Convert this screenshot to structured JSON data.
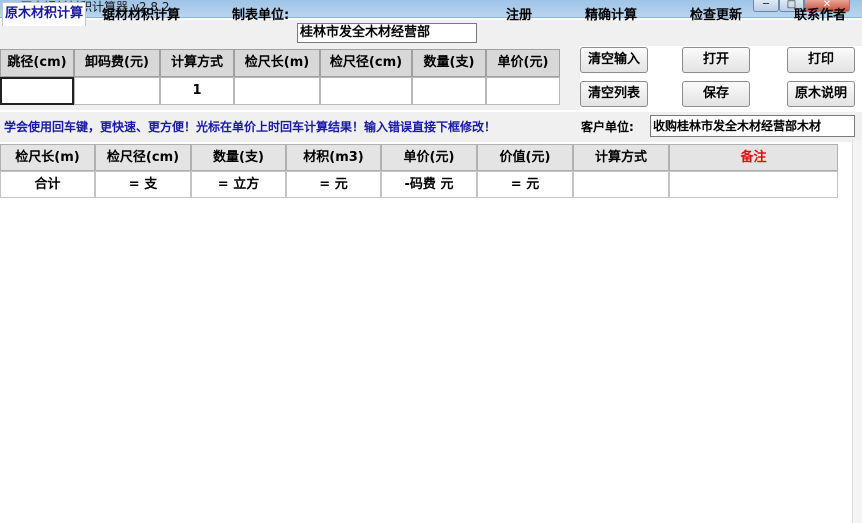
{
  "window": {
    "app_icon": "木",
    "title": "原木锯材材积计算器 v2.8.2",
    "min_glyph": "─",
    "max_glyph": "□",
    "close_glyph": "✕"
  },
  "menu": {
    "tab_log": "原木材积计算",
    "tab_sawn": "锯材材积计算",
    "unit_label": "制表单位:",
    "unit_value": "桂林市发全木材经营部",
    "register": "注册",
    "precise": "精确计算",
    "update": "检查更新",
    "contact": "联系作者"
  },
  "input_grid": {
    "headers": [
      "跳径(cm)",
      "卸码费(元)",
      "计算方式",
      "检尺长(m)",
      "检尺径(cm)",
      "数量(支)",
      "单价(元)"
    ],
    "values": [
      "",
      "",
      "1",
      "",
      "",
      "",
      ""
    ]
  },
  "buttons": {
    "clear_input": "清空输入",
    "open": "打开",
    "print": "打印",
    "clear_list": "清空列表",
    "save": "保存",
    "about": "原木说明"
  },
  "hint": {
    "text": "学会使用回车键，更快速、更方便！光标在单价上时回车计算结果！输入错误直接下框修改！",
    "client_label": "客户单位:",
    "client_value": "收购桂林市发全木材经营部木材"
  },
  "results": {
    "headers": [
      "检尺长(m)",
      "检尺径(cm)",
      "数量(支)",
      "材积(m3)",
      "单价(元)",
      "价值(元)",
      "计算方式",
      "备注"
    ],
    "total_row": [
      "合计",
      "= 支",
      "= 立方",
      "= 元",
      "-码费 元",
      "= 元",
      "",
      ""
    ]
  },
  "colors": {
    "remark_header": "#e01010",
    "hint_text": "#1a1aa8"
  }
}
